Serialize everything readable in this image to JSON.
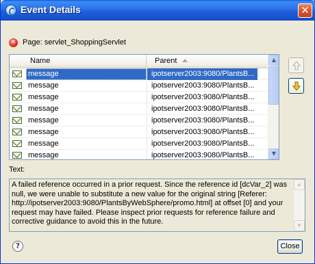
{
  "window": {
    "title": "Event Details",
    "close_glyph": "✕"
  },
  "page_info": {
    "label": "Page: servlet_ShoppingServlet",
    "icon": "error-icon"
  },
  "table": {
    "columns": [
      "Name",
      "Parent"
    ],
    "sort_column": "Parent",
    "sort_direction": "ascending",
    "rows": [
      {
        "name": "message",
        "parent": "ipotserver2003:9080/PlantsB...",
        "selected": true
      },
      {
        "name": "message",
        "parent": "ipotserver2003:9080/PlantsB...",
        "selected": false
      },
      {
        "name": "message",
        "parent": "ipotserver2003:9080/PlantsB...",
        "selected": false
      },
      {
        "name": "message",
        "parent": "ipotserver2003:9080/PlantsB...",
        "selected": false
      },
      {
        "name": "message",
        "parent": "ipotserver2003:9080/PlantsB...",
        "selected": false
      },
      {
        "name": "message",
        "parent": "ipotserver2003:9080/PlantsB...",
        "selected": false
      },
      {
        "name": "message",
        "parent": "ipotserver2003:9080/PlantsB...",
        "selected": false
      },
      {
        "name": "message",
        "parent": "ipotserver2003:9080/PlantsB...",
        "selected": false
      }
    ]
  },
  "nav": {
    "up_enabled": false,
    "down_enabled": true
  },
  "details": {
    "label": "Text:",
    "text": "A failed reference occurred in a prior request.  Since the reference id [dcVar_2] was null, we were unable to substitute a new value for the original string [Referer: http://ipotserver2003:9080/PlantsByWebSphere/promo.html] at offset [0] and your request may have failed.  Please inspect prior requests for reference failure and corrective guidance to avoid this in the future."
  },
  "footer": {
    "help_glyph": "?",
    "close_label": "Close"
  },
  "colors": {
    "selection": "#316ac5",
    "titlebar": "#1e5fd9",
    "dialog_bg": "#ece9d8"
  }
}
